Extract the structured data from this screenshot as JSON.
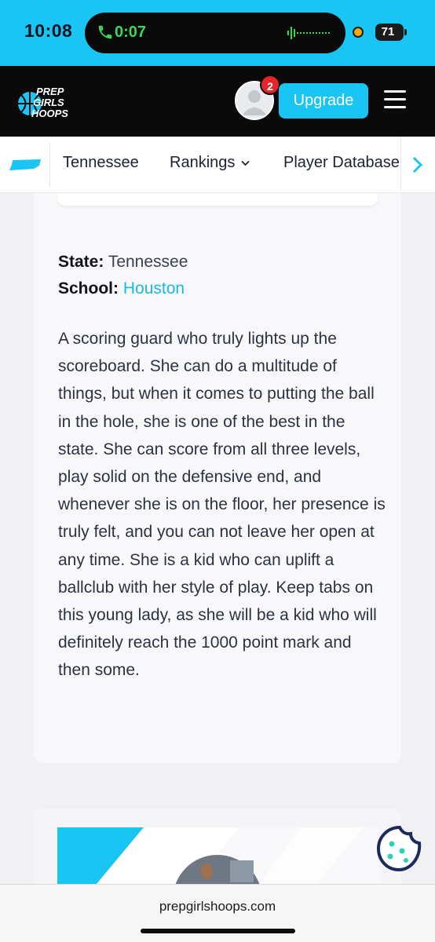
{
  "status_bar": {
    "time": "10:08",
    "call_duration": "0:07",
    "battery_level": "71",
    "colors": {
      "bar": "#19c5f2",
      "call_green": "#39d65a",
      "dot": "#f1a81b"
    }
  },
  "header": {
    "logo_lines": [
      "PREP",
      "GIRLS",
      "HOOPS"
    ],
    "notification_count": "2",
    "upgrade_label": "Upgrade",
    "icons": [
      "logo",
      "avatar-icon",
      "menu-icon"
    ]
  },
  "sub_nav": {
    "items": [
      {
        "label": "Tennessee"
      },
      {
        "label": "Rankings",
        "has_dropdown": true
      },
      {
        "label": "Player Database"
      }
    ],
    "icons": [
      "tennessee-shape-icon",
      "chevron-down-icon",
      "chevron-right-icon"
    ]
  },
  "profile": {
    "state_label": "State:",
    "state_value": "Tennessee",
    "school_label": "School:",
    "school_value": "Houston",
    "bio": "A scoring guard who truly lights up the scoreboard. She can do a multitude of things, but when it comes to putting the ball in the hole, she is one of the best in the state. She can score from all three levels, play solid on the defensive end, and whenever she is on the floor, her presence is truly felt, and you can not leave her open at any time. She is a kid who can uplift a ballclub with her style of play. Keep tabs on this young lady, as she will be a kid who will definitely reach the 1000 point mark and then some."
  },
  "browser": {
    "url": "prepgirlshoops.com"
  },
  "theme": {
    "accent": "#19c5f2",
    "header_bg": "#0a0a0a",
    "badge_red": "#e8242b",
    "link": "#19b8e6",
    "cookie_navy": "#1b2b5e"
  }
}
